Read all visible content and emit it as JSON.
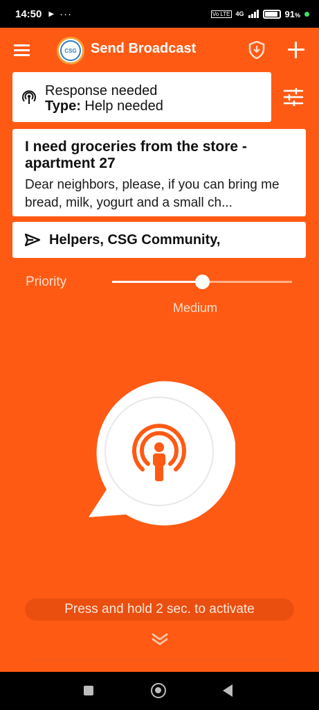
{
  "status_bar": {
    "time": "14:50",
    "play_glyph": "▶",
    "more_glyph": "···",
    "sim_label": "Vo LTE",
    "network": "4G",
    "battery_pct": "91",
    "battery_suffix": "%"
  },
  "app_bar": {
    "title": "Send Broadcast",
    "logo_text": "CSG",
    "menu_icon": "hamburger-menu-icon",
    "shield_icon": "shield-download-icon",
    "add_icon": "plus-icon"
  },
  "response": {
    "line1": "Response needed",
    "type_label": "Type:",
    "type_value": " Help needed",
    "icon": "broadcast-icon"
  },
  "filter_icon": "sliders-icon",
  "message": {
    "title": "I need groceries from the store - apartment 27",
    "body": "Dear neighbors, please, if you can bring me bread, milk, yogurt and a small ch..."
  },
  "recipients": {
    "text": "Helpers, CSG Community,",
    "icon": "send-icon"
  },
  "priority": {
    "label": "Priority",
    "value_label": "Medium",
    "level": 0.5
  },
  "activate": {
    "icon": "broadcast-person-icon",
    "hint": "Press and hold 2 sec. to activate"
  },
  "colors": {
    "background": "#ff5a14",
    "accent": "#ff5a14",
    "card": "#ffffff"
  },
  "nav": {
    "recents_icon": "square-icon",
    "home_icon": "circle-icon",
    "back_icon": "triangle-back-icon"
  }
}
